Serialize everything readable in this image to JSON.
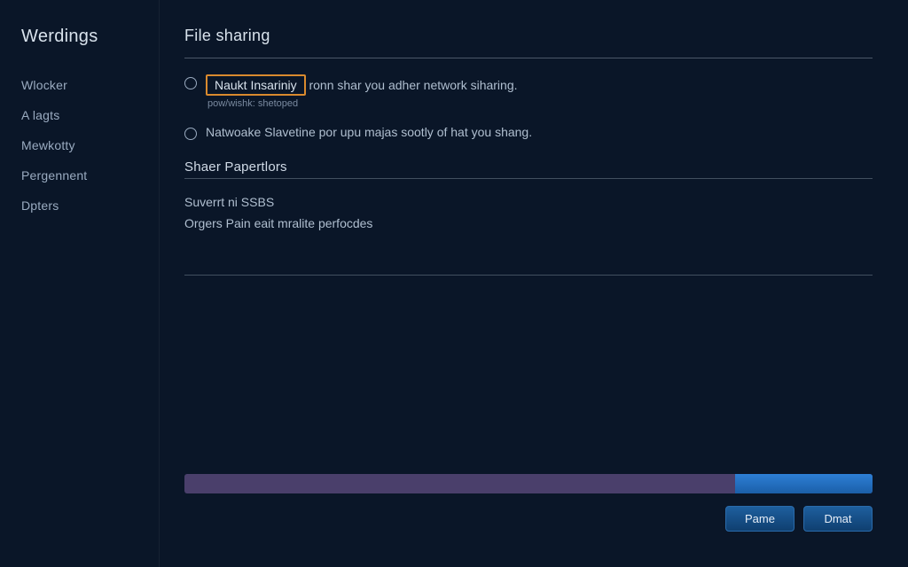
{
  "sidebar": {
    "title": "Werdings",
    "items": [
      {
        "label": "Wlocker"
      },
      {
        "label": "A lagts"
      },
      {
        "label": "Mewkotty"
      },
      {
        "label": "Pergennent"
      },
      {
        "label": "Dpters"
      }
    ]
  },
  "main": {
    "title": "File sharing",
    "options": [
      {
        "label": "Naukt Insariniy",
        "sub": "pow/wishk: shetoped",
        "trail": "ronn shar you adher network siharing."
      },
      {
        "label": "Natwoake Slavetine por upu majas sootly of hat you shang."
      }
    ],
    "section_label": "Shaer Papertlors",
    "properties": [
      "Suverrt ni SSBS",
      "Orgers Pain eait mralite perfocdes"
    ],
    "buttons": {
      "primary": "Pame",
      "secondary": "Dmat"
    },
    "progress_percent": 20
  }
}
